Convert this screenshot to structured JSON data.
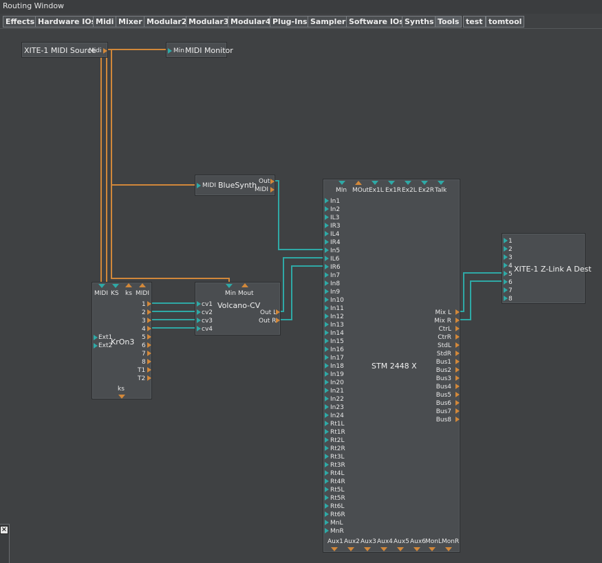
{
  "window": {
    "title": "Routing Window"
  },
  "tabs": [
    "Effects",
    "Hardware IOs",
    "Midi",
    "Mixer",
    "Modular2",
    "Modular3",
    "Modular4",
    "Plug-Ins",
    "Sampler",
    "Software IOs",
    "Synths",
    "Tools",
    "test",
    "tomtool"
  ],
  "colors": {
    "midi_wire": "#d2883a",
    "audio_wire": "#2fa9a6",
    "background": "#3f4143",
    "node": "#4a4d50"
  },
  "nodes": {
    "midi_source": {
      "title": "XITE-1 MIDI Source",
      "out_label": "Midi"
    },
    "midi_monitor": {
      "title": "MIDI Monitor",
      "in_label": "Min"
    },
    "bluesynth": {
      "title": "BlueSynth",
      "in_label": "MIDI",
      "outs": [
        "Out",
        "MIDI"
      ]
    },
    "kron3": {
      "title": "KrOn3",
      "top_ports": [
        "MIDI",
        "KS",
        "ks",
        "MIDI"
      ],
      "right_ports": [
        "1",
        "2",
        "3",
        "4",
        "5",
        "6",
        "7",
        "8",
        "T1",
        "T2"
      ],
      "left_ports": [
        "Ext1",
        "Ext2"
      ],
      "bottom_port": "ks"
    },
    "volcano": {
      "title": "Volcano-CV",
      "top_ports": [
        "Min",
        "Mout"
      ],
      "left_ports": [
        "cv1",
        "cv2",
        "cv3",
        "cv4"
      ],
      "right_ports": [
        "Out L",
        "Out R"
      ]
    },
    "stm": {
      "title": "STM 2448 X",
      "top_ports": [
        "MIn",
        "MOut",
        "Ex1L",
        "Ex1R",
        "Ex2L",
        "Ex2R",
        "Talk"
      ],
      "left_ports": [
        "In1",
        "In2",
        "IL3",
        "IR3",
        "IL4",
        "IR4",
        "In5",
        "IL6",
        "IR6",
        "In7",
        "In8",
        "In9",
        "In10",
        "In11",
        "In12",
        "In13",
        "In14",
        "In15",
        "In16",
        "In17",
        "In18",
        "In19",
        "In20",
        "In21",
        "In22",
        "In23",
        "In24",
        "Rt1L",
        "Rt1R",
        "Rt2L",
        "Rt2R",
        "Rt3L",
        "Rt3R",
        "Rt4L",
        "Rt4R",
        "Rt5L",
        "Rt5R",
        "Rt6L",
        "Rt6R",
        "MnL",
        "MnR"
      ],
      "right_ports": [
        "Mix L",
        "Mix R",
        "CtrL",
        "CtrR",
        "StdL",
        "StdR",
        "Bus1",
        "Bus2",
        "Bus3",
        "Bus4",
        "Bus5",
        "Bus6",
        "Bus7",
        "Bus8"
      ],
      "bottom_ports": [
        "Aux1",
        "Aux2",
        "Aux3",
        "Aux4",
        "Aux5",
        "Aux6",
        "MonL",
        "MonR"
      ]
    },
    "zlink": {
      "title": "XITE-1 Z-Link A Dest",
      "left_ports": [
        "1",
        "2",
        "3",
        "4",
        "5",
        "6",
        "7",
        "8"
      ]
    }
  },
  "close_icon": "×"
}
